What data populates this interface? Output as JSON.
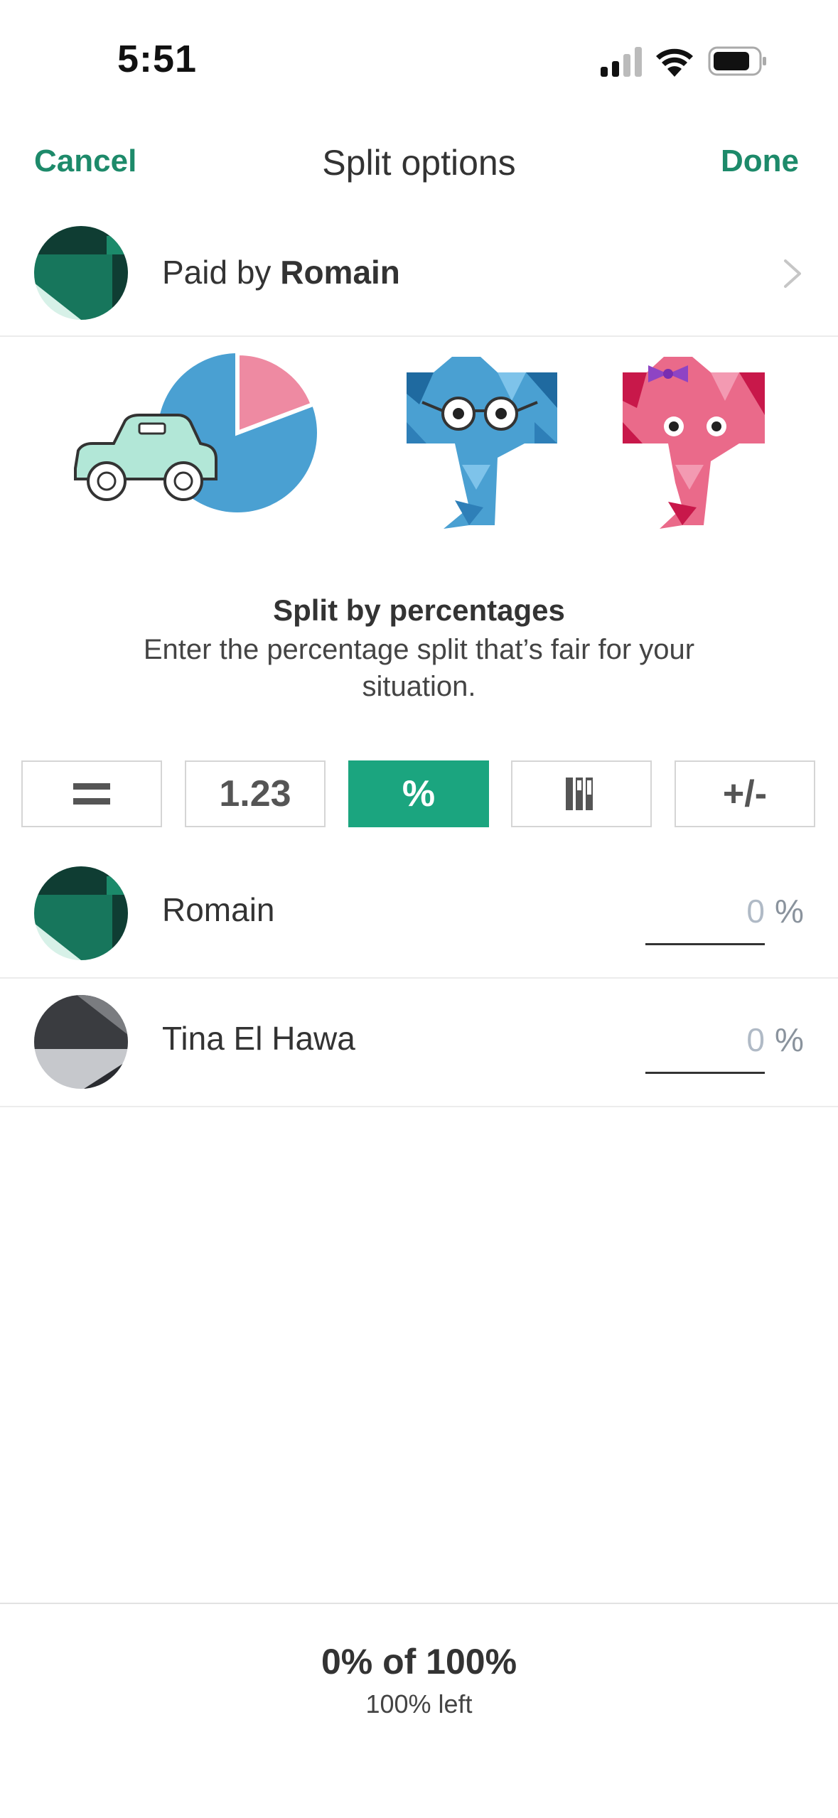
{
  "status_bar": {
    "time": "5:51"
  },
  "nav": {
    "cancel": "Cancel",
    "title": "Split options",
    "done": "Done"
  },
  "payer": {
    "prefix": "Paid by ",
    "name": "Romain"
  },
  "split": {
    "title": "Split by percentages",
    "description": "Enter the percentage split that’s fair for your situation."
  },
  "modes": [
    {
      "label": "=",
      "icon": "equal-icon",
      "active": false
    },
    {
      "label": "1.23",
      "icon": "exact-amount",
      "active": false
    },
    {
      "label": "%",
      "icon": "percent-icon",
      "active": true
    },
    {
      "label": "",
      "icon": "shares-bars-icon",
      "active": false
    },
    {
      "label": "+/-",
      "icon": "adjustment-icon",
      "active": false
    }
  ],
  "members": [
    {
      "name": "Romain",
      "value": "0",
      "unit": "%"
    },
    {
      "name": "Tina El Hawa",
      "value": "0",
      "unit": "%"
    }
  ],
  "footer": {
    "total": "0% of 100%",
    "left": "100% left"
  },
  "colors": {
    "accent": "#1ba57f",
    "nav_text": "#1d8a6a"
  }
}
